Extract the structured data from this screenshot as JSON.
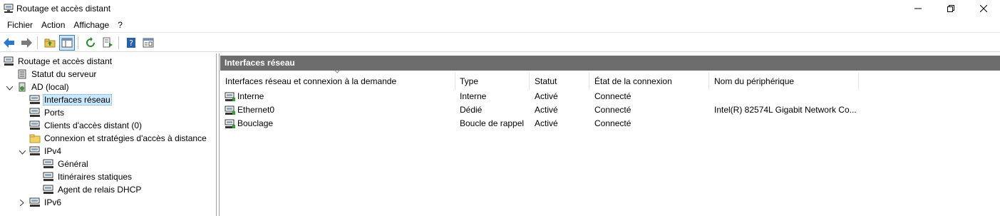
{
  "window": {
    "title": "Routage et accès distant",
    "app_icon": "server-icon"
  },
  "menu": [
    "Fichier",
    "Action",
    "Affichage",
    "?"
  ],
  "toolbar": {
    "icons": [
      "back-arrow-icon",
      "forward-arrow-icon",
      "up-folder-icon",
      "show-hide-tree-icon",
      "refresh-icon",
      "export-list-icon",
      "help-icon",
      "properties-icon"
    ]
  },
  "tree": {
    "root": "Routage et accès distant",
    "server_status": "Statut du serveur",
    "server": "AD (local)",
    "network_interfaces": "Interfaces réseau",
    "ports": "Ports",
    "remote_clients": "Clients d'accès distant (0)",
    "access_policies": "Connexion et stratégies d'accès à distance",
    "ipv4": "IPv4",
    "general": "Général",
    "static_routes": "Itinéraires statiques",
    "dhcp_relay": "Agent de relais DHCP",
    "ipv6": "IPv6"
  },
  "pane": {
    "title": "Interfaces réseau",
    "columns": [
      "Interfaces réseau et connexion à la demande",
      "Type",
      "Statut",
      "État de la connexion",
      "Nom du périphérique"
    ],
    "rows": [
      [
        "Interne",
        "Interne",
        "Activé",
        "Connecté",
        ""
      ],
      [
        "Ethernet0",
        "Dédié",
        "Activé",
        "Connecté",
        "Intel(R) 82574L Gigabit Network Co..."
      ],
      [
        "Bouclage",
        "Boucle de rappel",
        "Activé",
        "Connecté",
        ""
      ]
    ]
  },
  "colors": {
    "pane_header_bg": "#6d6d6d",
    "selection_bg": "#cce8ff",
    "toolbar_active_bg": "#cce4f7"
  }
}
